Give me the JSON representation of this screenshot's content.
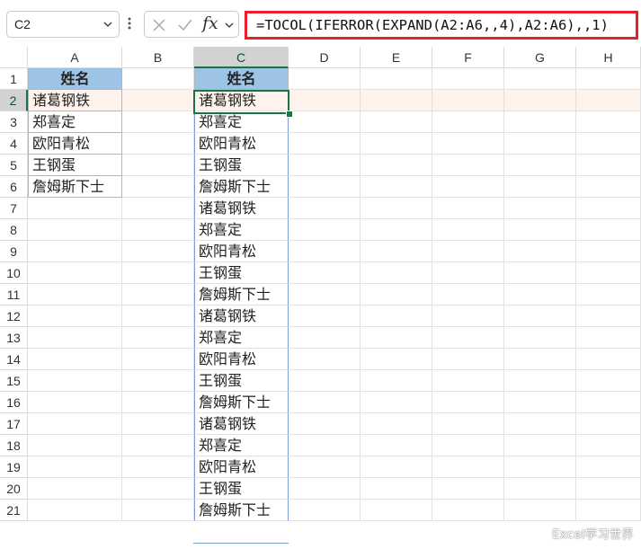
{
  "formula_bar": {
    "name_box": "C2",
    "fx_label": "fx",
    "formula": "=TOCOL(IFERROR(EXPAND(A2:A6,,4),A2:A6),,1)"
  },
  "columns": [
    "A",
    "B",
    "C",
    "D",
    "E",
    "F",
    "G",
    "H"
  ],
  "rows": [
    "1",
    "2",
    "3",
    "4",
    "5",
    "6",
    "7",
    "8",
    "9",
    "10",
    "11",
    "12",
    "13",
    "14",
    "15",
    "16",
    "17",
    "18",
    "19",
    "20",
    "21"
  ],
  "cells": {
    "A1": "姓名",
    "A2": "诸葛钢铁",
    "A3": "郑喜定",
    "A4": "欧阳青松",
    "A5": "王钢蛋",
    "A6": "詹姆斯下士",
    "C1": "姓名",
    "C_spill": [
      "诸葛钢铁",
      "郑喜定",
      "欧阳青松",
      "王钢蛋",
      "詹姆斯下士",
      "诸葛钢铁",
      "郑喜定",
      "欧阳青松",
      "王钢蛋",
      "詹姆斯下士",
      "诸葛钢铁",
      "郑喜定",
      "欧阳青松",
      "王钢蛋",
      "詹姆斯下士",
      "诸葛钢铁",
      "郑喜定",
      "欧阳青松",
      "王钢蛋",
      "詹姆斯下士"
    ]
  },
  "watermark": "Excel学习世界",
  "colors": {
    "header_fill": "#9dc3e6",
    "selection": "#1a7343",
    "highlight_row": "#fdf2ec",
    "formula_border": "#e8202a"
  }
}
